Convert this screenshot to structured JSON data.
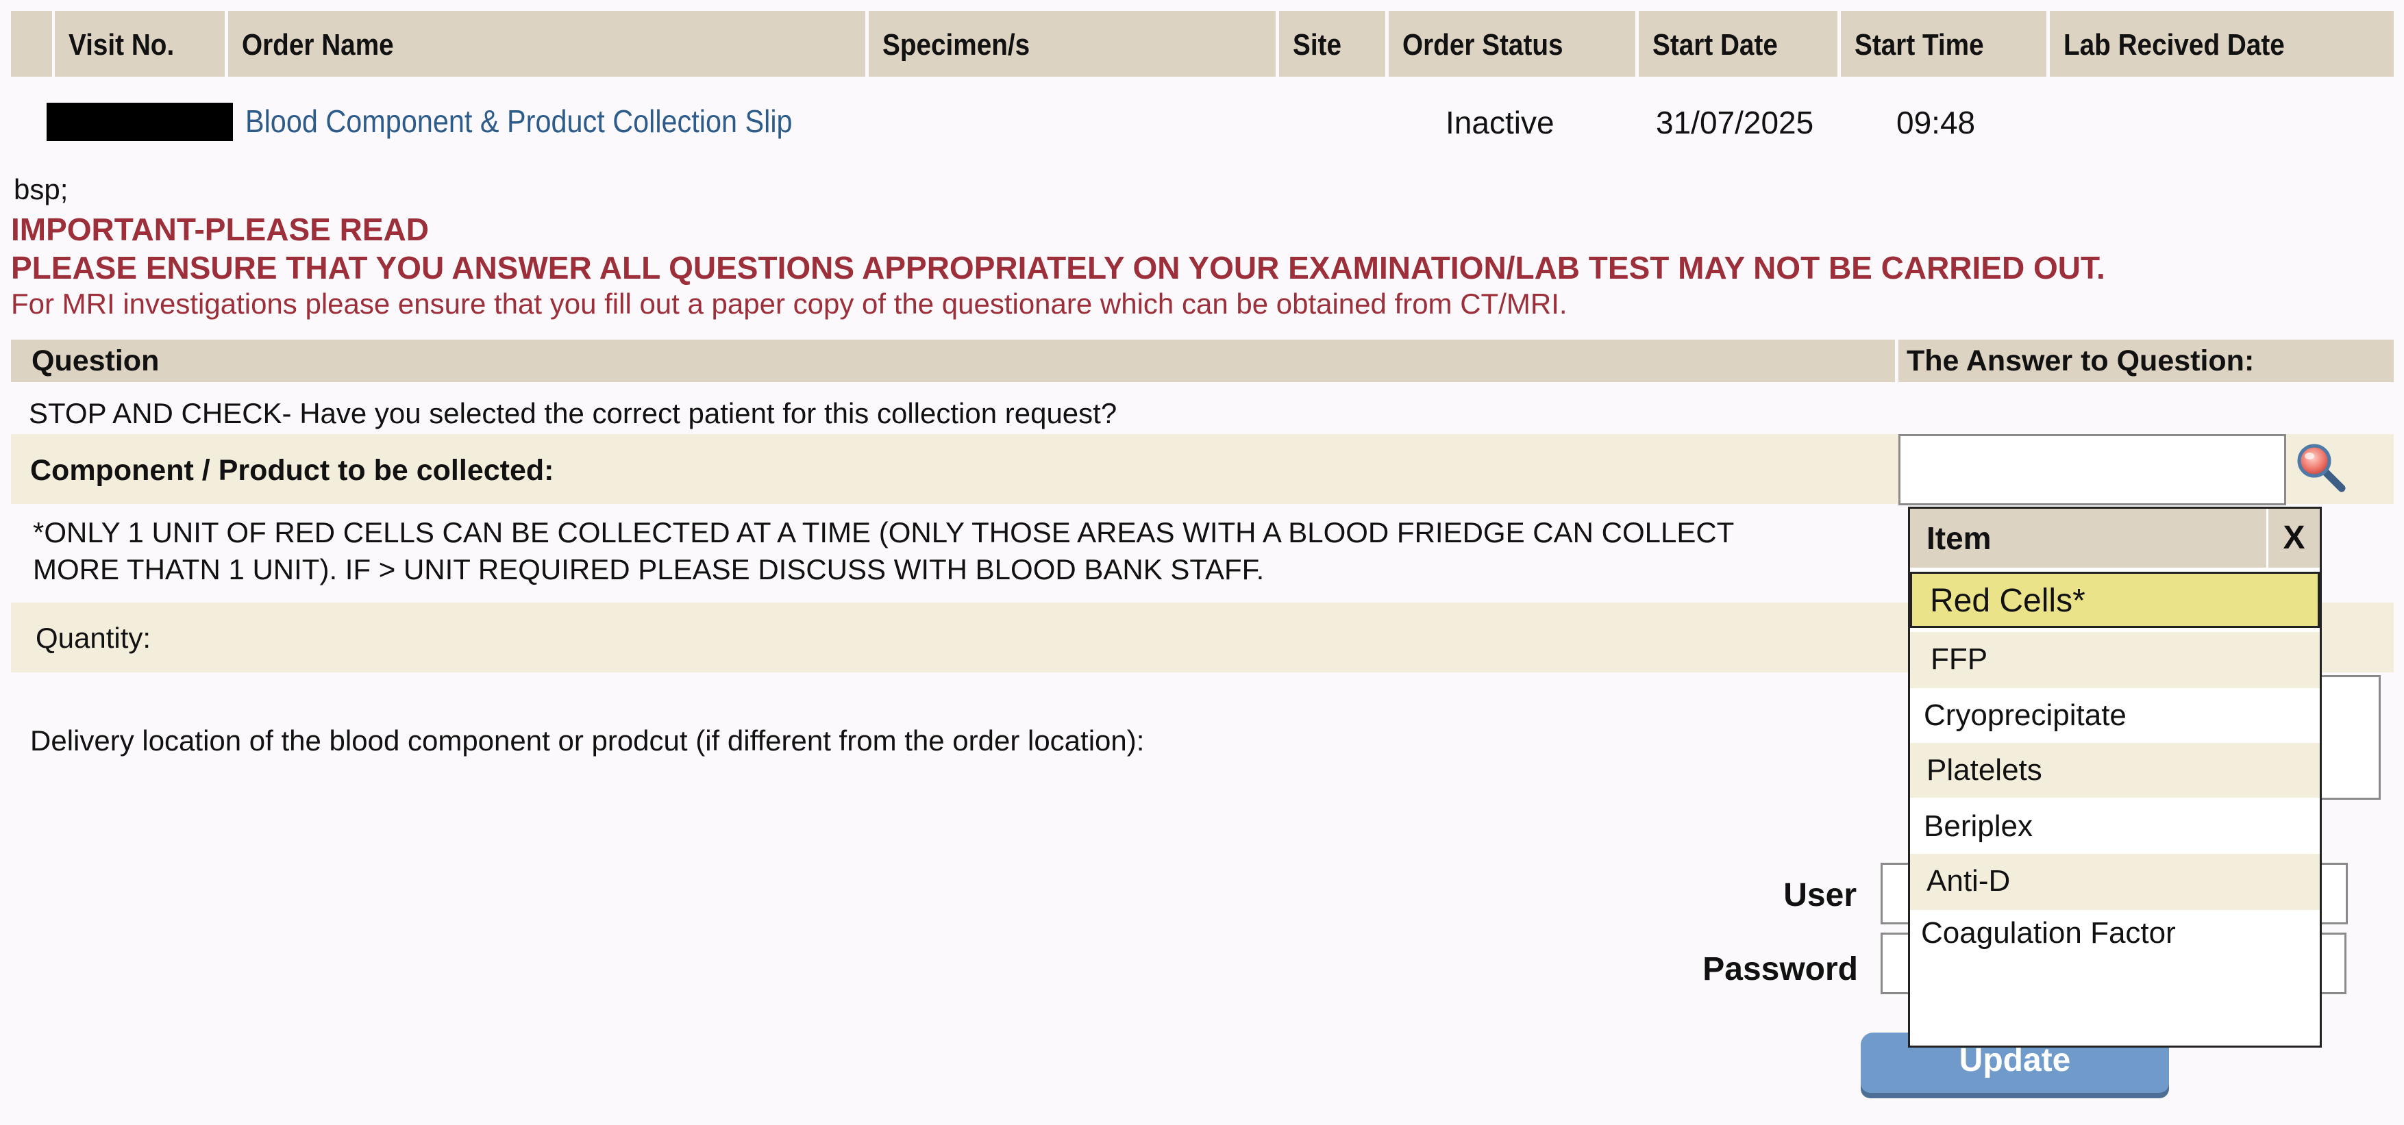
{
  "order_table": {
    "columns": [
      "Visit No.",
      "Order Name",
      "Specimen/s",
      "Site",
      "Order Status",
      "Start Date",
      "Start Time",
      "Lab Recived Date"
    ],
    "row": {
      "order_name": "Blood Component & Product Collection Slip",
      "order_status": "Inactive",
      "start_date": "31/07/2025",
      "start_time": "09:48"
    }
  },
  "notice": {
    "stray": "bsp;",
    "heading": "IMPORTANT-PLEASE READ",
    "line1": "PLEASE ENSURE THAT YOU ANSWER ALL QUESTIONS APPROPRIATELY ON YOUR EXAMINATION/LAB TEST MAY NOT BE CARRIED OUT.",
    "line2": "For MRI investigations please ensure that you fill out a paper copy of the questionare which can be obtained from CT/MRI."
  },
  "questions": {
    "col_question": "Question",
    "col_answer": "The Answer to Question:",
    "q1": "STOP AND CHECK- Have you selected the correct patient for this collection request?",
    "q2": "Component / Product to be collected:",
    "note_line1": "*ONLY 1 UNIT OF RED CELLS CAN BE COLLECTED AT A TIME (ONLY THOSE AREAS WITH A BLOOD FRIEDGE CAN COLLECT",
    "note_line2": "MORE THATN 1 UNIT). IF > UNIT REQUIRED PLEASE DISCUSS WITH BLOOD BANK STAFF.",
    "q3": "Quantity:",
    "q4": "Delivery location of the blood component or prodcut (if different from the order location):"
  },
  "dropdown": {
    "header": "Item",
    "close": "X",
    "items": [
      "Red Cells*",
      "FFP",
      "Cryoprecipitate",
      "Platelets",
      "Beriplex",
      "Anti-D",
      "Coagulation Factor"
    ],
    "selected": "Red Cells*"
  },
  "login": {
    "user_label": "User",
    "password_label": "Password",
    "update_label": "Update"
  },
  "colors": {
    "header_bg": "#ddd3c3",
    "band_bg": "#f3eedc",
    "warning_red": "#9c2f3a",
    "link_blue": "#2e5c8a",
    "selected_item": "#ebe389",
    "button_blue": "#6f9ac9"
  }
}
